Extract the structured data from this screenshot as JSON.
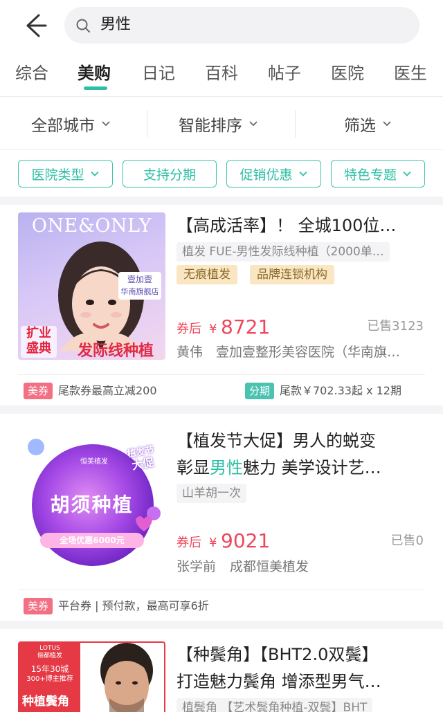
{
  "search": {
    "query": "男性"
  },
  "tabs": [
    "综合",
    "美购",
    "日记",
    "百科",
    "帖子",
    "医院",
    "医生"
  ],
  "filters": {
    "city": "全部城市",
    "sort": "智能排序",
    "screen": "筛选"
  },
  "chips": [
    "医院类型",
    "支持分期",
    "促销优惠",
    "特色专题"
  ],
  "items": [
    {
      "title": "【高成活率】！ 全城100位…",
      "subtitle": "植发 FUE-男性发际线种植（2000单…",
      "badges": [
        "无痕植发",
        "品牌连锁机构"
      ],
      "price_label": "券后",
      "currency": "¥",
      "price": "8721",
      "sold": "已售3123",
      "doctor": "黄伟",
      "hospital": "壹加壹整形美容医院（华南旗…",
      "coupon_tag": "美券",
      "coupon_text": "尾款券最高立减200",
      "install_tag": "分期",
      "install_text": "尾款￥702.33起 x 12期",
      "thumb": {
        "brand": "ONE&ONLY",
        "store": "壹加壹",
        "store2": "华南旗舰店",
        "left_tag": "扩业",
        "left_tag2": "盛典",
        "caption": "发际线种植"
      }
    },
    {
      "title_line1": "【植发节大促】男人的蜕变",
      "title_line2_pre": "彰显",
      "title_line2_hl": "男性",
      "title_line2_post": "魅力 美学设计艺…",
      "subtitle": "山羊胡一次",
      "price_label": "券后",
      "currency": "¥",
      "price": "9021",
      "sold": "已售0",
      "doctor": "张学前",
      "hospital": "成都恒美植发",
      "coupon_tag": "美券",
      "coupon_text": "平台券 | 预付款，最高可享6折",
      "thumb": {
        "logo": "恒美植发",
        "sticker1": "植发节",
        "sticker2": "大促",
        "caption": "胡须种植",
        "promo": "全场优惠6000元"
      }
    },
    {
      "title_line1": "【种鬓角】【BHT2.0双鬓】",
      "title_line2": "打造魅力鬓角 增添型男气…",
      "subtitle": "植鬓角 【艺术鬓角种植-双鬓】BHT",
      "thumb": {
        "brand": "LOTUS",
        "brand_sub": "俪都植发",
        "line1": "15年30城",
        "line2": "300+博主推荐",
        "caption": "种植鬓角"
      }
    }
  ]
}
